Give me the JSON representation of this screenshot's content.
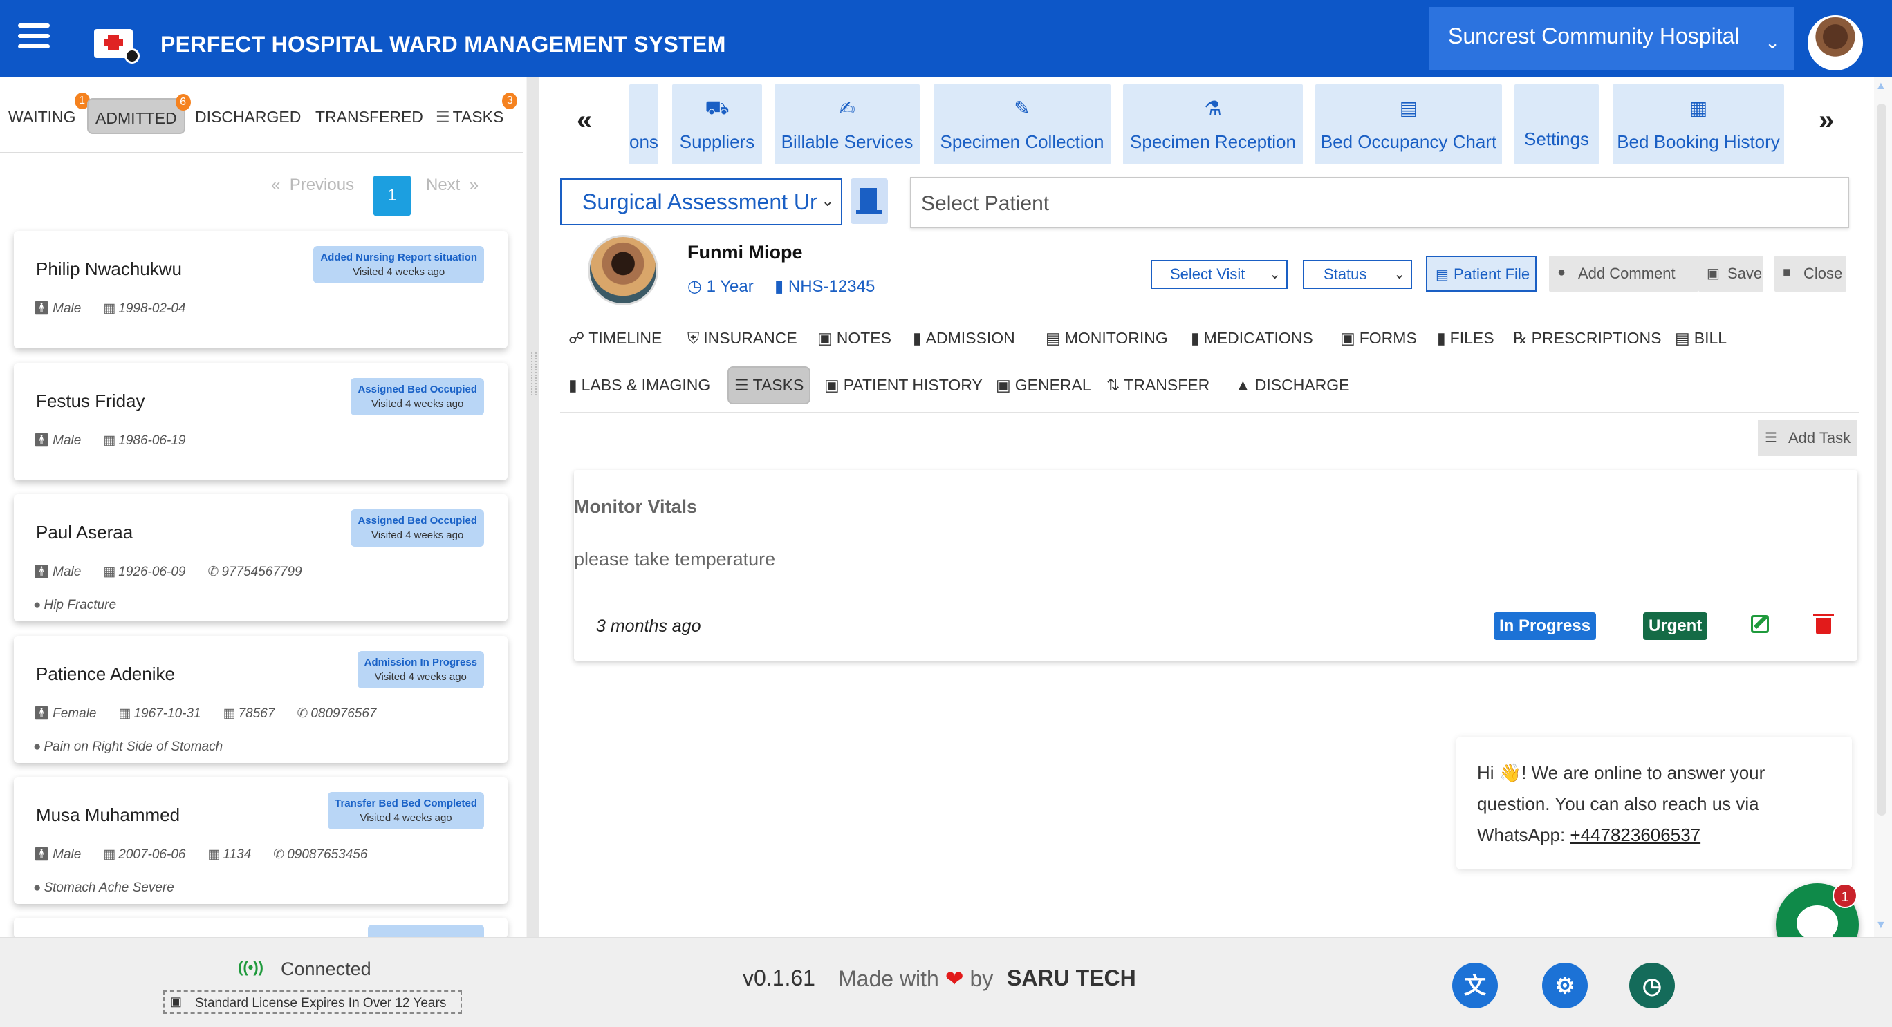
{
  "header": {
    "title": "PERFECT HOSPITAL WARD MANAGEMENT SYSTEM",
    "hospital": "Suncrest Community Hospital",
    "menu_icon": "hamburger-icon",
    "logo_icon": "hospital-logo-icon"
  },
  "left": {
    "tabs": [
      {
        "label": "WAITING",
        "badge": "1"
      },
      {
        "label": "ADMITTED",
        "badge": "6"
      },
      {
        "label": "DISCHARGED",
        "badge": ""
      },
      {
        "label": "TRANSFERED",
        "badge": ""
      },
      {
        "label": "TASKS",
        "badge": "3"
      }
    ],
    "pager": {
      "prev": "Previous",
      "page": "1",
      "next": "Next",
      "prev_chev": "«",
      "next_chev": "»"
    },
    "patients": [
      {
        "name": "Philip Nwachukwu",
        "badge": "Added Nursing Report situation",
        "visited": "Visited 4 weeks ago",
        "gender": "Male",
        "dob": "1998-02-04",
        "id": "",
        "phone": "",
        "condition": ""
      },
      {
        "name": "Festus Friday",
        "badge": "Assigned Bed Occupied",
        "visited": "Visited 4 weeks ago",
        "gender": "Male",
        "dob": "1986-06-19",
        "id": "",
        "phone": "",
        "condition": ""
      },
      {
        "name": "Paul Aseraa",
        "badge": "Assigned Bed Occupied",
        "visited": "Visited 4 weeks ago",
        "gender": "Male",
        "dob": "1926-06-09",
        "id": "",
        "phone": "97754567799",
        "condition": "Hip Fracture"
      },
      {
        "name": "Patience Adenike",
        "badge": "Admission In Progress",
        "visited": "Visited 4 weeks ago",
        "gender": "Female",
        "dob": "1967-10-31",
        "id": "78567",
        "phone": "080976567",
        "condition": "Pain on Right Side of Stomach"
      },
      {
        "name": "Musa Muhammed",
        "badge": "Transfer Bed Bed Completed",
        "visited": "Visited 4 weeks ago",
        "gender": "Male",
        "dob": "2007-06-06",
        "id": "1134",
        "phone": "09087653456",
        "condition": "Stomach Ache Severe"
      }
    ]
  },
  "nav": {
    "left_arrow": "«",
    "right_arrow": "»",
    "tiles": [
      {
        "label": "ons",
        "icon": ""
      },
      {
        "label": "Suppliers",
        "icon": "truck-icon"
      },
      {
        "label": "Billable Services",
        "icon": "hand-icon"
      },
      {
        "label": "Specimen Collection",
        "icon": "syringe-icon"
      },
      {
        "label": "Specimen Reception",
        "icon": "flask-icon"
      },
      {
        "label": "Bed Occupancy Chart",
        "icon": "bed-icon"
      },
      {
        "label": "Settings",
        "icon": ""
      },
      {
        "label": "Bed Booking History",
        "icon": "calendar-icon"
      }
    ]
  },
  "ward": {
    "value": "Surgical Assessment Unit"
  },
  "patient_select": {
    "placeholder": "Select  Patient"
  },
  "patient": {
    "name": "Funmi Miope",
    "age": "1 Year",
    "nhs": "NHS-12345"
  },
  "controls": {
    "visit": "Select Visit",
    "status": "Status",
    "file": "Patient File",
    "comment": "Add Comment",
    "save": "Save",
    "close": "Close"
  },
  "tabs_row1": [
    "TIMELINE",
    "INSURANCE",
    "NOTES",
    "ADMISSION",
    "MONITORING",
    "MEDICATIONS",
    "FORMS",
    "FILES",
    "PRESCRIPTIONS",
    "BILL"
  ],
  "tabs_row2": [
    "LABS & IMAGING",
    "TASKS",
    "PATIENT HISTORY",
    "GENERAL",
    "TRANSFER",
    "DISCHARGE"
  ],
  "tasks": {
    "add_label": "Add Task",
    "items": [
      {
        "title": "Monitor Vitals",
        "description": "please take temperature",
        "time": "3 months ago",
        "status": "In Progress",
        "priority": "Urgent"
      }
    ]
  },
  "chat": {
    "greeting": "Hi 👋! We are online to answer your question. You can also reach us via WhatsApp:",
    "phone": "+447823606537",
    "unread": "1"
  },
  "footer": {
    "connection": "Connected",
    "license": "Standard License Expires In Over 12 Years",
    "version": "v0.1.61",
    "made_with": "Made with",
    "by": "by",
    "brand": "SARU TECH",
    "buttons": [
      "translate-icon",
      "settings-icon",
      "alarm-icon"
    ]
  },
  "colors": {
    "primary": "#0d57c8",
    "accent": "#1a5fc4",
    "success": "#146b46",
    "danger": "#e21b1b",
    "badge": "#f5821f"
  }
}
